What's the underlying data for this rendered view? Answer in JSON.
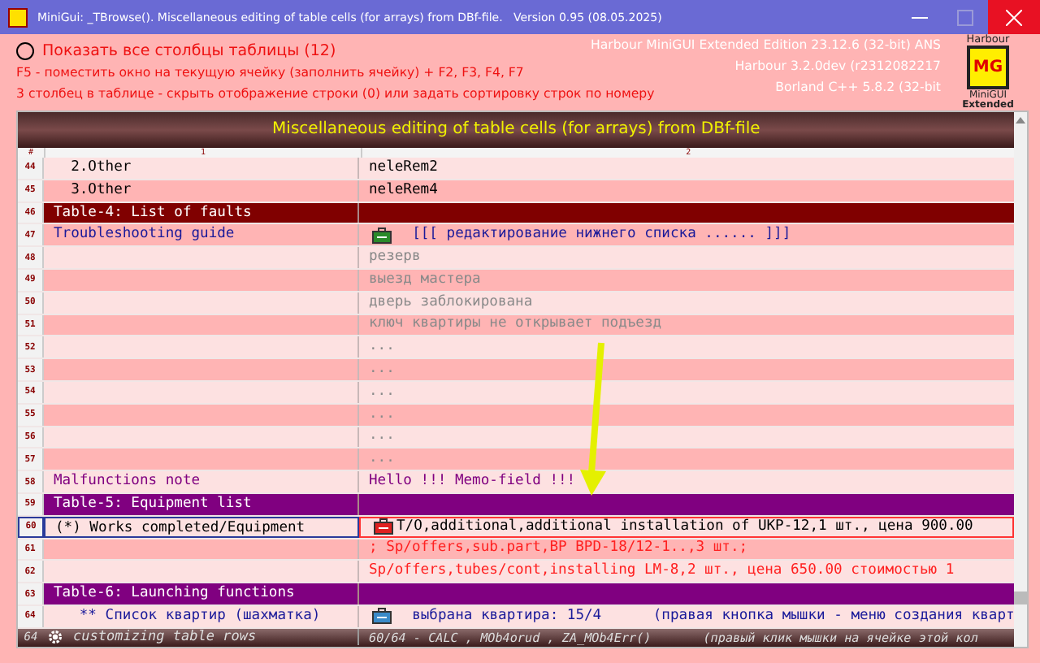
{
  "window": {
    "title": "MiniGui: _TBrowse(). Miscellaneous editing of table cells (for arrays) from DBf-file.   Version 0.95 (08.05.2025)"
  },
  "show_all": {
    "label": "Показать все столбцы таблицы (12)",
    "checked": false
  },
  "hints": [
    "F5 - поместить окно на текущую ячейку (заполнить ячейку) + F2, F3, F4, F7",
    "3 столбец в таблице - скрыть отображение строки (0) или задать сортировку строк по номеру"
  ],
  "versions": [
    "Harbour MiniGUI Extended Edition 23.12.6 (32-bit) ANS",
    "Harbour 3.2.0dev (r2312082217",
    "Borland C++ 5.8.2 (32-bit"
  ],
  "logo": {
    "top": "Harbour",
    "mark": "MG",
    "name": "MiniGUI",
    "sub": "Extended"
  },
  "table": {
    "title": "Miscellaneous editing of table cells (for arrays) from DBf-file",
    "columns": [
      "#",
      "1",
      "2"
    ],
    "rows": [
      {
        "num": "44",
        "kind": "item",
        "selected": false,
        "cells": [
          {
            "text": "  2.Other",
            "color": "#000000"
          },
          {
            "text": "neleRem2",
            "color": "#000000"
          }
        ]
      },
      {
        "num": "45",
        "kind": "item",
        "selected": false,
        "cells": [
          {
            "text": "  3.Other",
            "color": "#000000"
          },
          {
            "text": "neleRem4",
            "color": "#000000"
          }
        ]
      },
      {
        "num": "46",
        "kind": "section",
        "color": "#800000",
        "selected": false,
        "title": "Table-4: List of faults"
      },
      {
        "num": "47",
        "kind": "item",
        "selected": false,
        "cells": [
          {
            "text": "Troubleshooting guide",
            "color": "#1a1a9a"
          },
          {
            "text": "  [[[ редактирование нижнего списка ...... ]]]",
            "color": "#1a1a9a",
            "icon": {
              "color": "#2a8a2a"
            }
          }
        ]
      },
      {
        "num": "48",
        "kind": "item",
        "selected": false,
        "cells": [
          {},
          {
            "text": "резерв",
            "color": "#8a8a8a"
          }
        ]
      },
      {
        "num": "49",
        "kind": "item",
        "selected": false,
        "cells": [
          {},
          {
            "text": "выезд мастера",
            "color": "#8a8a8a"
          }
        ]
      },
      {
        "num": "50",
        "kind": "item",
        "selected": false,
        "cells": [
          {},
          {
            "text": "дверь заблокирована",
            "color": "#8a8a8a"
          }
        ]
      },
      {
        "num": "51",
        "kind": "item",
        "selected": false,
        "cells": [
          {},
          {
            "text": "ключ квартиры не открывает подъезд",
            "color": "#8a8a8a"
          }
        ]
      },
      {
        "num": "52",
        "kind": "item",
        "selected": false,
        "cells": [
          {},
          {
            "text": "...",
            "color": "#8a8a8a"
          }
        ]
      },
      {
        "num": "53",
        "kind": "item",
        "selected": false,
        "cells": [
          {},
          {
            "text": "...",
            "color": "#8a8a8a"
          }
        ]
      },
      {
        "num": "54",
        "kind": "item",
        "selected": false,
        "cells": [
          {},
          {
            "text": "...",
            "color": "#8a8a8a"
          }
        ]
      },
      {
        "num": "55",
        "kind": "item",
        "selected": false,
        "cells": [
          {},
          {
            "text": "...",
            "color": "#8a8a8a"
          }
        ]
      },
      {
        "num": "56",
        "kind": "item",
        "selected": false,
        "cells": [
          {},
          {
            "text": "...",
            "color": "#8a8a8a"
          }
        ]
      },
      {
        "num": "57",
        "kind": "item",
        "selected": false,
        "cells": [
          {},
          {
            "text": "...",
            "color": "#8a8a8a"
          }
        ]
      },
      {
        "num": "58",
        "kind": "item",
        "selected": false,
        "cells": [
          {
            "text": "Malfunctions note",
            "color": "#800080"
          },
          {
            "text": "Hello !!! Memo-field !!!",
            "color": "#800080"
          }
        ]
      },
      {
        "num": "59",
        "kind": "section",
        "color": "#800080",
        "selected": false,
        "title": "Table-5: Equipment list"
      },
      {
        "num": "60",
        "kind": "item",
        "selected": true,
        "cells": [
          {
            "text": "(*) Works completed/Equipment",
            "color": "#000000"
          },
          {
            "text": "T/O,additional,additional installation of UKP-12,1 шт., цена 900.00",
            "color": "#000000",
            "icon": {
              "color": "#e02020"
            }
          }
        ]
      },
      {
        "num": "61",
        "kind": "item",
        "selected": false,
        "cells": [
          {},
          {
            "text": "; Sp/offers,sub.part,BP BPD-18/12-1..,3 шт.;",
            "color": "#ff2020"
          }
        ]
      },
      {
        "num": "62",
        "kind": "item",
        "selected": false,
        "cells": [
          {},
          {
            "text": "Sp/offers,tubes/cont,installing LM-8,2 шт., цена 650.00 стоимостью 1",
            "color": "#ff2020"
          }
        ]
      },
      {
        "num": "63",
        "kind": "section",
        "color": "#800080",
        "selected": false,
        "title": "Table-6: Launching functions"
      },
      {
        "num": "64",
        "kind": "item",
        "selected": false,
        "cells": [
          {
            "text": "   ** Список квартир (шахматка)",
            "color": "#1a1a9a"
          },
          {
            "text": "  выбрана квартира: 15/4      (правая кнопка мышки - меню создания кварт",
            "color": "#1a1a9a",
            "icon": {
              "color": "#3a8ac8"
            }
          }
        ]
      }
    ],
    "footer": {
      "count": "64",
      "label": "customizing table rows",
      "info": "60/64 - CALC , MOb4orud , ZA_MOb4Err()       (правый клик мышки на ячейке этой кол"
    }
  }
}
